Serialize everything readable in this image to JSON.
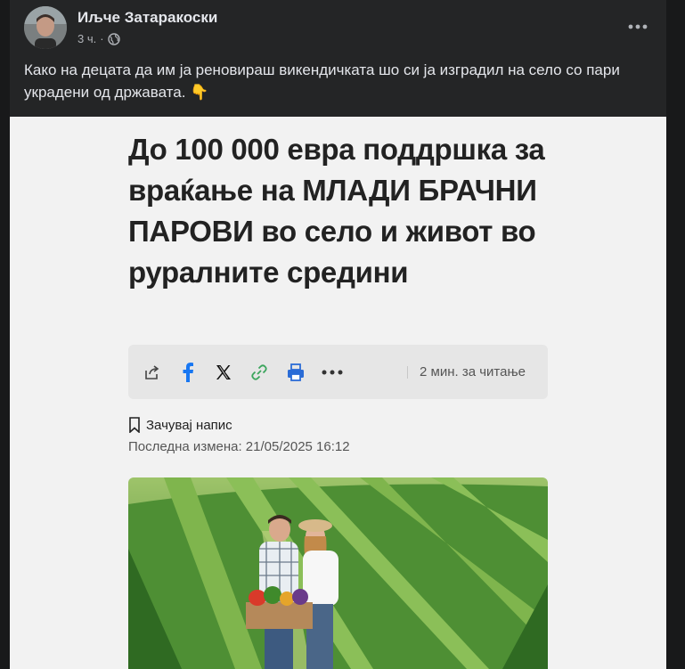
{
  "post": {
    "author": "Иљче Затаракоски",
    "time": "3 ч.",
    "separator": "·",
    "text": "Како на децата да им ја реновираш викендичката шо си ја изградил на село со пари украдени од државата. 👇"
  },
  "article": {
    "headline": "До 100 000 евра поддршка за враќање на МЛАДИ БРАЧНИ ПАРОВИ во село и живот во руралните средини",
    "share_icons": [
      "share-icon",
      "facebook-icon",
      "x-icon",
      "link-icon",
      "print-icon",
      "more-icon"
    ],
    "read_time": "2 мин. за читање",
    "save_label": "Зачувај напис",
    "updated": "Последна измена: 21/05/2025 16:12"
  },
  "colors": {
    "post_bg": "#242526",
    "article_bg": "#f2f2f2",
    "facebook": "#1877f2",
    "link": "#3ba55c",
    "print": "#2b6cd6"
  }
}
